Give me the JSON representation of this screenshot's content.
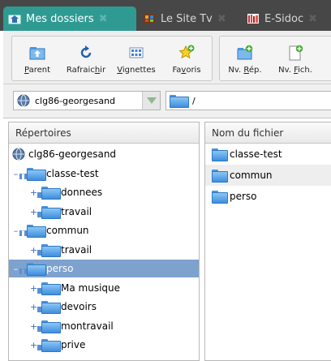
{
  "tabs": [
    {
      "label": "Mes dossiers",
      "active": true,
      "icon": "folder-home-icon"
    },
    {
      "label": "Le Site Tv",
      "active": false,
      "icon": "film-icon"
    },
    {
      "label": "E-Sidoc",
      "active": false,
      "icon": "bookshelf-icon"
    }
  ],
  "toolbar": {
    "parent": {
      "pre": "",
      "key": "P",
      "post": "arent",
      "icon": "folder-up-icon"
    },
    "refresh": {
      "pre": "Rafraic",
      "key": "h",
      "post": "ir",
      "icon": "refresh-icon"
    },
    "thumbnails": {
      "pre": "",
      "key": "V",
      "post": "ignettes",
      "icon": "thumbnails-icon"
    },
    "favorites": {
      "pre": "Fa",
      "key": "v",
      "post": "oris",
      "icon": "star-add-icon"
    },
    "new_dir": {
      "pre": "Nv. ",
      "key": "R",
      "post": "ép.",
      "icon": "new-folder-icon"
    },
    "new_file": {
      "pre": "Nv. ",
      "key": "F",
      "post": "ich.",
      "icon": "new-file-icon"
    }
  },
  "address": {
    "server": "clg86-georgesand",
    "path": "/"
  },
  "tree": {
    "header": "Répertoires",
    "root": "clg86-georgesand",
    "items": [
      {
        "label": "classe-test",
        "level": 1,
        "expander": "–"
      },
      {
        "label": "donnees",
        "level": 2,
        "expander": "+"
      },
      {
        "label": "travail",
        "level": 2,
        "expander": "+"
      },
      {
        "label": "commun",
        "level": 1,
        "expander": "–"
      },
      {
        "label": "travail",
        "level": 2,
        "expander": "+"
      },
      {
        "label": "perso",
        "level": 1,
        "expander": "–",
        "selected": true
      },
      {
        "label": "Ma musique",
        "level": 2,
        "expander": "+"
      },
      {
        "label": "devoirs",
        "level": 2,
        "expander": "+"
      },
      {
        "label": "montravail",
        "level": 2,
        "expander": "+"
      },
      {
        "label": "prive",
        "level": 2,
        "expander": "+"
      }
    ]
  },
  "files": {
    "header": "Nom du fichier",
    "items": [
      "classe-test",
      "commun",
      "perso"
    ]
  },
  "colors": {
    "active_tab": "#2f9a92",
    "selection": "#7da2ce",
    "folder": "#3f8ede"
  }
}
